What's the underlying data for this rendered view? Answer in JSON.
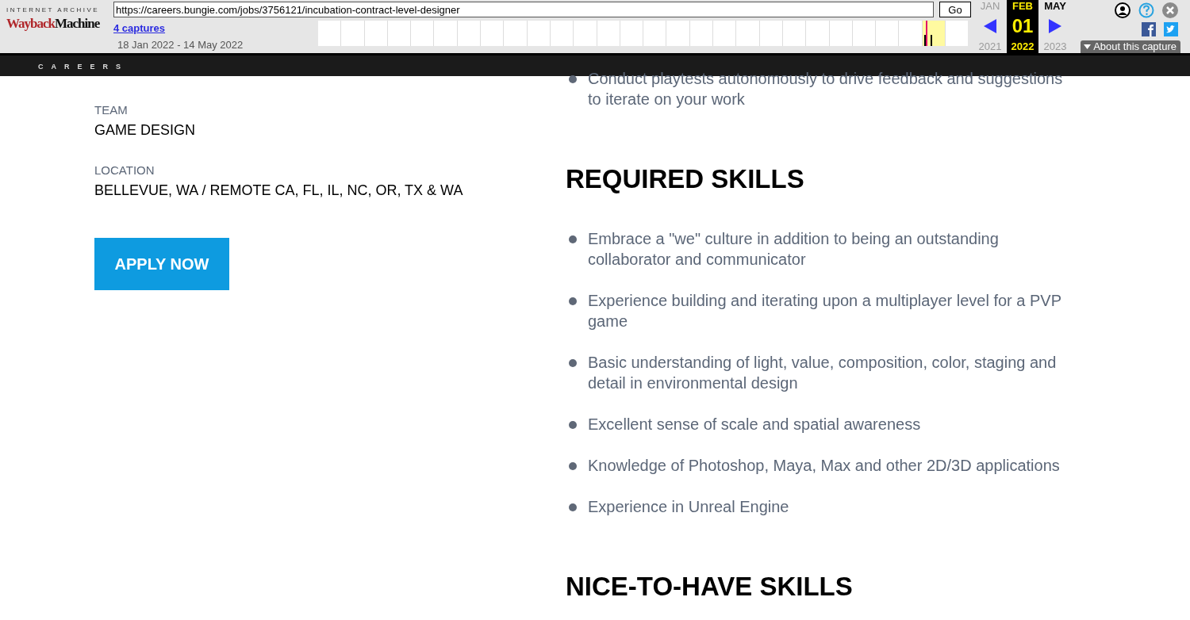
{
  "wayback": {
    "brand_top": "INTERNET ARCHIVE",
    "brand_left": "Wayback",
    "brand_right": "Machine",
    "url": "https://careers.bungie.com/jobs/3756121/incubation-contract-level-designer",
    "go": "Go",
    "captures": "4 captures",
    "range": "18 Jan 2022 - 14 May 2022",
    "months": [
      {
        "label": "JAN",
        "selected": false
      },
      {
        "label": "FEB",
        "selected": true
      },
      {
        "label": "MAY",
        "selected": false
      }
    ],
    "day": "01",
    "years": [
      {
        "label": "2021",
        "selected": false
      },
      {
        "label": "2022",
        "selected": true
      },
      {
        "label": "2023",
        "selected": false
      }
    ],
    "about": "About this capture"
  },
  "site": {
    "subtitle": "CAREERS"
  },
  "details": [
    {
      "label": "TEAM",
      "value": "GAME DESIGN"
    },
    {
      "label": "LOCATION",
      "value": "BELLEVUE, WA / REMOTE CA, FL, IL, NC, OR, TX & WA"
    }
  ],
  "apply": "APPLY NOW",
  "top_bullets": [
    "Conduct playtests autonomously to drive feedback and suggestions to iterate on your work"
  ],
  "sections": [
    {
      "heading": "REQUIRED SKILLS",
      "bullets": [
        "Embrace a \"we\" culture in addition to being an outstanding collaborator and communicator",
        "Experience building and iterating upon a multiplayer level for a PVP game",
        "Basic understanding of light, value, composition, color, staging and detail in environmental design",
        "Excellent sense of scale and spatial awareness",
        "Knowledge of Photoshop, Maya, Max and other 2D/3D applications",
        "Experience in Unreal Engine"
      ]
    },
    {
      "heading": "NICE-TO-HAVE SKILLS"
    }
  ]
}
